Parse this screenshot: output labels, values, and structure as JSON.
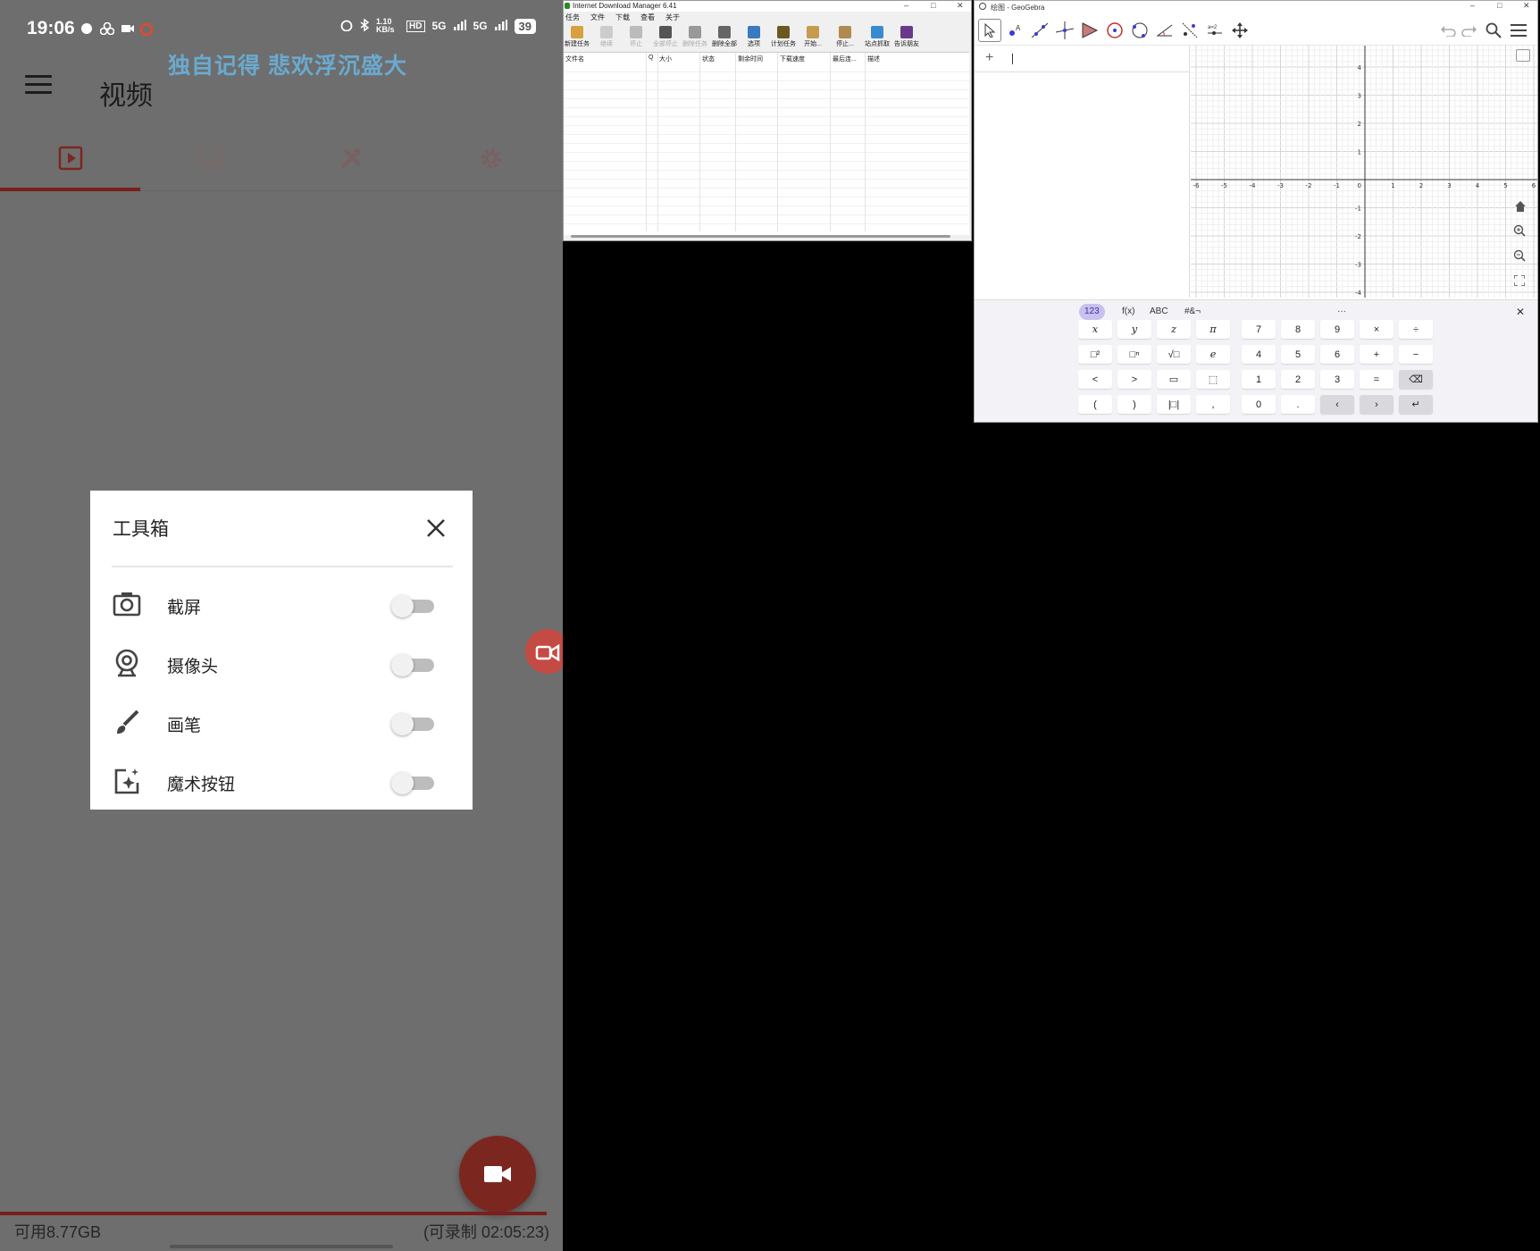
{
  "phone": {
    "status": {
      "time": "19:06",
      "net_speed": "1.10 KB/s",
      "hd": "HD",
      "signal1": "5G",
      "signal2": "5G",
      "battery": "39"
    },
    "marquee_text": "独自记得 悲欢浮沉盛大",
    "app_title": "视频",
    "tabs": [
      {
        "name": "video",
        "icon": "play-icon",
        "active": true
      },
      {
        "name": "image",
        "icon": "image-icon",
        "active": false
      },
      {
        "name": "tools",
        "icon": "tools-icon",
        "active": false
      },
      {
        "name": "settings",
        "icon": "gear-icon",
        "active": false
      }
    ],
    "dialog": {
      "title": "工具箱",
      "items": [
        {
          "label": "截屏",
          "icon": "camera-icon",
          "on": false
        },
        {
          "label": "摄像头",
          "icon": "webcam-icon",
          "on": false
        },
        {
          "label": "画笔",
          "icon": "brush-icon",
          "on": false
        },
        {
          "label": "魔术按钮",
          "icon": "magic-button-icon",
          "on": false
        }
      ]
    },
    "storage_text": "可用8.77GB",
    "remaining_text": "(可录制 02:05:23)",
    "colors": {
      "accent": "#7b2720",
      "overlay_bg": "#6e6e6e",
      "marquee": "#6aaad0"
    }
  },
  "idm": {
    "title": "Internet Download Manager 6.41",
    "menu": [
      "任务",
      "文件",
      "下载",
      "查看",
      "关于"
    ],
    "toolbar": [
      "新建任务",
      "继续",
      "停止",
      "全部停止",
      "删除任务",
      "删除全部",
      "选项",
      "计划任务",
      "开始...",
      "停止...",
      "站点抓取",
      "告诉朋友"
    ],
    "columns": [
      "文件名",
      "Q",
      "大小",
      "状态",
      "剩余时间",
      "下载速度",
      "最后连...",
      "描述"
    ]
  },
  "geogebra": {
    "title": "绘图 - GeoGebra",
    "input_plus": "+",
    "graph": {
      "x_ticks": [
        "-6",
        "-5",
        "-4",
        "-3",
        "-2",
        "-1",
        "0",
        "1",
        "2",
        "3",
        "4",
        "5",
        "6"
      ],
      "y_ticks": [
        "4",
        "3",
        "2",
        "1",
        "-1",
        "-2",
        "-3",
        "-4"
      ]
    },
    "keyboard": {
      "tabs": [
        "123",
        "f(x)",
        "ABC",
        "#&¬"
      ],
      "more": "···",
      "left_keys": [
        [
          "x",
          "y",
          "z",
          "π"
        ],
        [
          "□²",
          "□ⁿ",
          "√□",
          "e"
        ],
        [
          "<",
          ">",
          "▭",
          "⬚"
        ],
        [
          "(",
          ")",
          "|□|",
          ","
        ]
      ],
      "right_keys": [
        [
          "7",
          "8",
          "9",
          "×",
          "÷"
        ],
        [
          "4",
          "5",
          "6",
          "+",
          "−"
        ],
        [
          "1",
          "2",
          "3",
          "=",
          "⌫"
        ],
        [
          "0",
          ".",
          "‹",
          "›",
          "↵"
        ]
      ]
    }
  }
}
